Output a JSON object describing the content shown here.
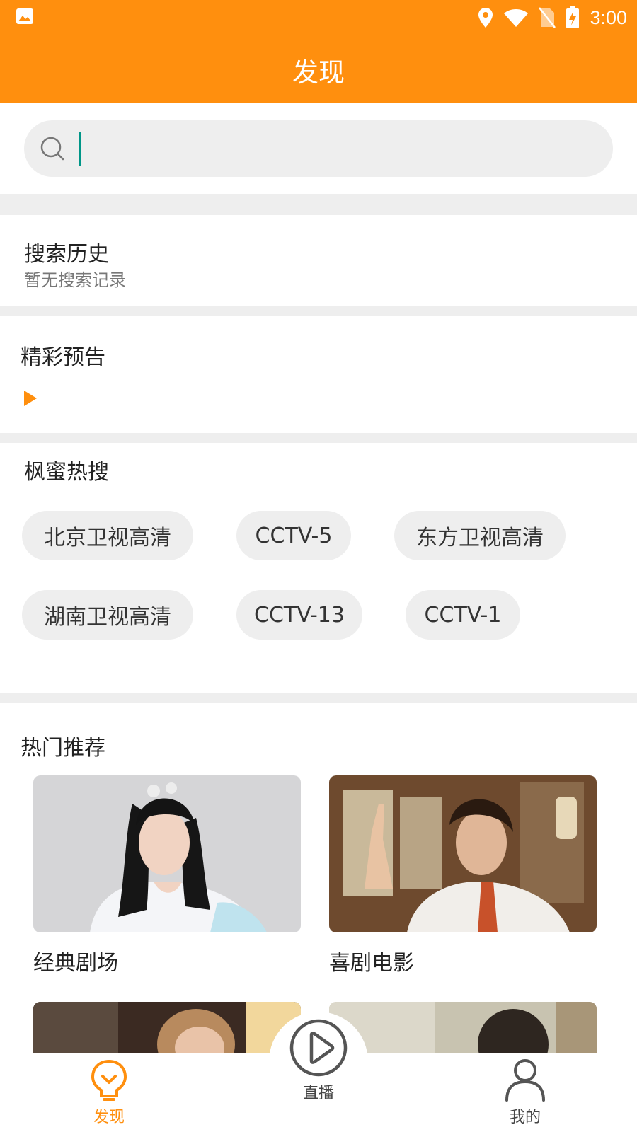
{
  "status_bar": {
    "time": "3:00",
    "icons": [
      "image-icon",
      "location-icon",
      "wifi-icon",
      "no-sim-icon",
      "battery-charging-icon"
    ]
  },
  "header": {
    "title": "发现"
  },
  "search": {
    "placeholder": "",
    "value": ""
  },
  "history": {
    "title": "搜索历史",
    "empty_text": "暂无搜索记录"
  },
  "preview": {
    "title": "精彩预告"
  },
  "hot_search": {
    "title": "枫蜜热搜",
    "tags": [
      "北京卫视高清",
      "CCTV-5",
      "东方卫视高清",
      "湖南卫视高清",
      "CCTV-13",
      "CCTV-1"
    ]
  },
  "recommend": {
    "title": "热门推荐",
    "cards": [
      {
        "label": "经典剧场"
      },
      {
        "label": "喜剧电影"
      }
    ]
  },
  "bottom_nav": {
    "items": [
      {
        "label": "发现",
        "icon": "lightbulb-icon",
        "active": true
      },
      {
        "label": "直播",
        "icon": "play-circle-icon",
        "active": false
      },
      {
        "label": "我的",
        "icon": "user-icon",
        "active": false
      }
    ]
  },
  "colors": {
    "accent": "#FF8F0E",
    "caret": "#009688",
    "tag_bg": "#EEEEEE",
    "divider": "#EEEEEE"
  }
}
